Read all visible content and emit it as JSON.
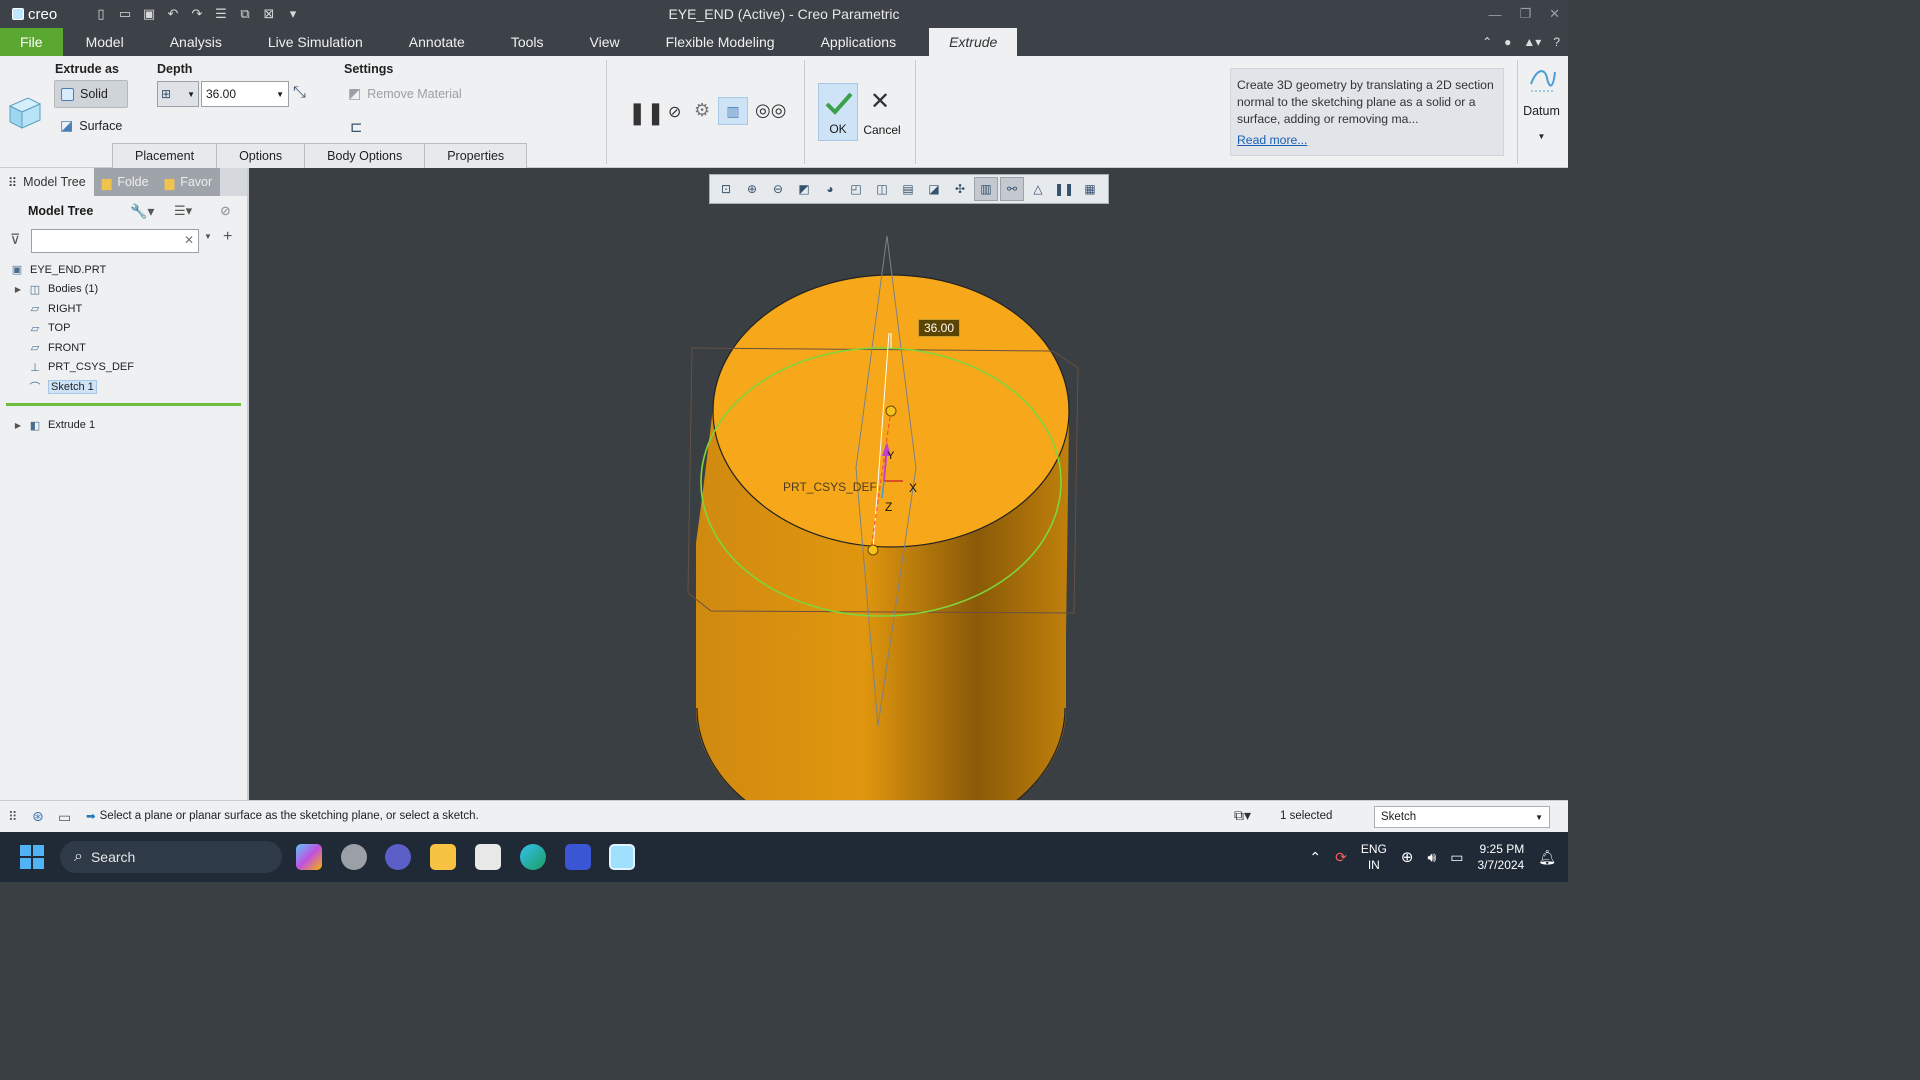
{
  "app": {
    "logo_text": "creo",
    "window_title": "EYE_END (Active) - Creo Parametric"
  },
  "menu": {
    "tabs": [
      "File",
      "Model",
      "Analysis",
      "Live Simulation",
      "Annotate",
      "Tools",
      "View",
      "Flexible Modeling",
      "Applications"
    ],
    "active_tab": "Extrude"
  },
  "ribbon": {
    "extrude_as_label": "Extrude as",
    "solid_label": "Solid",
    "surface_label": "Surface",
    "depth_label": "Depth",
    "depth_value": "36.00",
    "settings_label": "Settings",
    "remove_material_label": "Remove Material",
    "subtabs": [
      "Placement",
      "Options",
      "Body Options",
      "Properties"
    ],
    "ok_label": "OK",
    "cancel_label": "Cancel",
    "help_text": "Create 3D geometry by translating a 2D section normal to the sketching plane as a solid or a surface, adding or removing ma...",
    "help_link": "Read more...",
    "datum_label": "Datum"
  },
  "left_panel": {
    "tabs": [
      "Model Tree",
      "Folde",
      "Favor"
    ],
    "tree_title": "Model Tree",
    "tree_items": [
      {
        "label": "EYE_END.PRT",
        "icon": "part-icon"
      },
      {
        "label": "Bodies (1)",
        "icon": "bodies-icon"
      },
      {
        "label": "RIGHT",
        "icon": "datum-plane-icon"
      },
      {
        "label": "TOP",
        "icon": "datum-plane-icon"
      },
      {
        "label": "FRONT",
        "icon": "datum-plane-icon"
      },
      {
        "label": "PRT_CSYS_DEF",
        "icon": "csys-icon"
      },
      {
        "label": "Sketch 1",
        "icon": "sketch-icon"
      }
    ],
    "pending_item": "Extrude 1"
  },
  "viewport": {
    "dimension_value": "36.00",
    "csys_label": "PRT_CSYS_DEF",
    "axis_x": "X",
    "axis_y": "Y",
    "axis_z": "Z"
  },
  "status": {
    "message": "Select a plane or planar surface as the sketching plane, or select a sketch.",
    "selected": "1 selected",
    "filter_value": "Sketch"
  },
  "taskbar": {
    "search_label": "Search",
    "lang_line1": "ENG",
    "lang_line2": "IN",
    "time": "9:25 PM",
    "date": "3/7/2024"
  },
  "colors": {
    "file_tab": "#5aa832",
    "part_orange": "#f6a81a",
    "sketch_green": "#7dd63b"
  }
}
